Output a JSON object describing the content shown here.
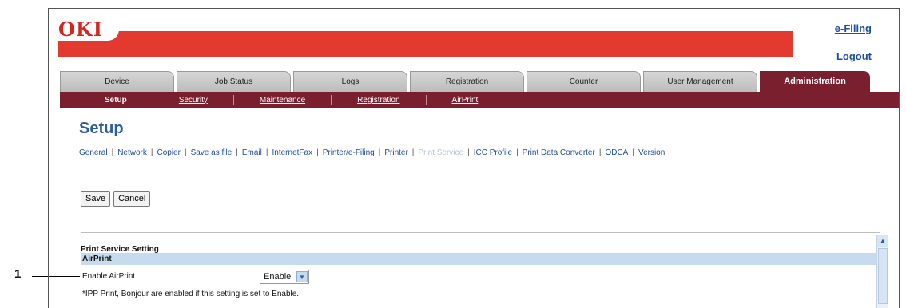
{
  "callout": {
    "number": "1"
  },
  "header": {
    "logo": "OKI",
    "efiling_link": "e-Filing",
    "logout_link": "Logout",
    "banner_color": "#e23a2f"
  },
  "tabs": [
    {
      "label": "Device"
    },
    {
      "label": "Job Status"
    },
    {
      "label": "Logs"
    },
    {
      "label": "Registration"
    },
    {
      "label": "Counter"
    },
    {
      "label": "User Management"
    },
    {
      "label": "Administration",
      "active": true
    }
  ],
  "subnav": [
    {
      "label": "Setup",
      "active": true
    },
    {
      "label": "Security"
    },
    {
      "label": "Maintenance"
    },
    {
      "label": "Registration"
    },
    {
      "label": "AirPrint"
    }
  ],
  "page": {
    "title": "Setup"
  },
  "settings_nav": [
    {
      "label": "General"
    },
    {
      "label": "Network"
    },
    {
      "label": "Copier"
    },
    {
      "label": "Save as file"
    },
    {
      "label": "Email"
    },
    {
      "label": "InternetFax"
    },
    {
      "label": "Printer/e-Filing"
    },
    {
      "label": "Printer"
    },
    {
      "label": "Print Service",
      "current": true
    },
    {
      "label": "ICC Profile"
    },
    {
      "label": "Print Data Converter"
    },
    {
      "label": "ODCA"
    },
    {
      "label": "Version"
    }
  ],
  "buttons": {
    "save": "Save",
    "cancel": "Cancel"
  },
  "section": {
    "title": "Print Service Setting",
    "header": "AirPrint",
    "row_label": "Enable AirPrint",
    "select_value": "Enable",
    "note": "*IPP Print, Bonjour are enabled if this setting is set to Enable."
  },
  "colors": {
    "accent": "#7a1f2e",
    "link": "#1f4e99",
    "title": "#2e5d9e",
    "section_header": "#c7dbef"
  }
}
